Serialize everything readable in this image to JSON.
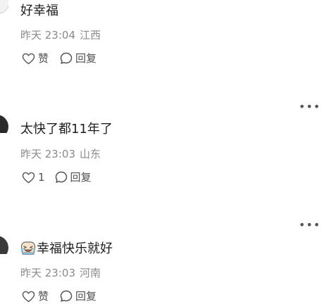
{
  "comments": [
    {
      "text": "好幸福",
      "time": "昨天 23:04",
      "location": "江西",
      "like_label": "赞",
      "reply_label": "回复",
      "show_more": false
    },
    {
      "text": "太快了都11年了",
      "time": "昨天 23:03",
      "location": "山东",
      "like_label": "1",
      "reply_label": "回复",
      "show_more": true
    },
    {
      "text": "幸福快乐就好",
      "emoji": "laughing-crying-emoji-icon",
      "time": "昨天 23:03",
      "location": "河南",
      "like_label": "赞",
      "reply_label": "回复",
      "show_more": true
    }
  ],
  "more_label": "•••",
  "colors": {
    "text": "#1f1f1f",
    "meta": "#8a8a8a",
    "action": "#505050"
  }
}
